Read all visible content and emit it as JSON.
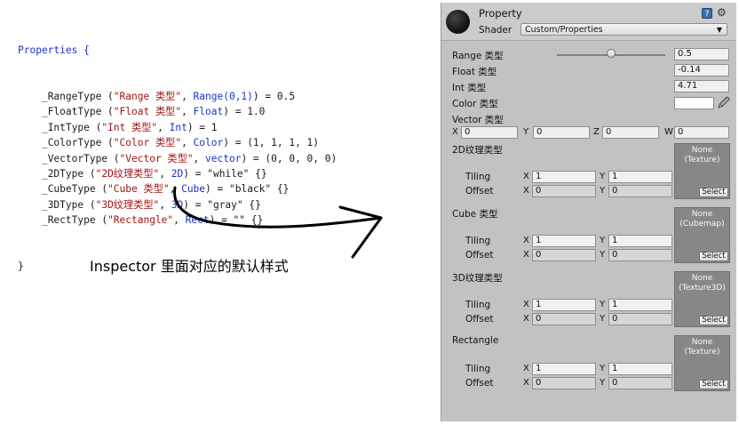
{
  "code": {
    "open": "Properties {",
    "close": "}",
    "lines": [
      {
        "name": "_RangeType",
        "label": "\"Range 类型\"",
        "type": "Range(0,1)",
        "value": "0.5"
      },
      {
        "name": "_FloatType",
        "label": "\"Float 类型\"",
        "type": "Float",
        "value": "1.0"
      },
      {
        "name": "_IntType",
        "label": "\"Int 类型\"",
        "type": "Int",
        "value": "1"
      },
      {
        "name": "_ColorType",
        "label": "\"Color 类型\"",
        "type": "Color",
        "value": "(1, 1, 1, 1)"
      },
      {
        "name": "_VectorType",
        "label": "\"Vector 类型\"",
        "type": "vector",
        "value": "(0, 0, 0, 0)"
      },
      {
        "name": "_2DType",
        "label": "\"2D纹理类型\"",
        "type": "2D",
        "value": "\"while\" {}"
      },
      {
        "name": "_CubeType",
        "label": "\"Cube 类型\"",
        "type": "Cube",
        "value": "\"black\" {}"
      },
      {
        "name": "_3DType",
        "label": "\"3D纹理类型\"",
        "type": "3D",
        "value": "\"gray\" {}"
      },
      {
        "name": "_RectType",
        "label": "\"Rectangle\"",
        "type": "Rect",
        "value": "\"\" {}"
      }
    ]
  },
  "caption": "Inspector 里面对应的默认样式",
  "inspector": {
    "title": "Property",
    "shader_label": "Shader",
    "shader_value": "Custom/Properties",
    "help_icon": "help-book-icon",
    "gear_icon": "gear-icon",
    "range": {
      "label": "Range 类型",
      "value": "0.5",
      "slider_fraction": 0.5
    },
    "float": {
      "label": "Float 类型",
      "value": "-0.14"
    },
    "int": {
      "label": "Int 类型",
      "value": "4.71"
    },
    "color": {
      "label": "Color 类型",
      "swatch": "#ffffff"
    },
    "vector": {
      "label": "Vector 类型",
      "x_label": "X",
      "y_label": "Y",
      "z_label": "Z",
      "w_label": "W",
      "x": "0",
      "y": "0",
      "z": "0",
      "w": "0"
    },
    "textures": [
      {
        "label": "2D纹理类型",
        "tiling_label": "Tiling",
        "offset_label": "Offset",
        "tiling_x": "1",
        "tiling_y": "1",
        "offset_x": "0",
        "offset_y": "0",
        "slot_line1": "None",
        "slot_line2": "(Texture)",
        "select": "Select"
      },
      {
        "label": "Cube 类型",
        "tiling_label": "Tiling",
        "offset_label": "Offset",
        "tiling_x": "1",
        "tiling_y": "1",
        "offset_x": "0",
        "offset_y": "0",
        "slot_line1": "None",
        "slot_line2": "(Cubemap)",
        "select": "Select"
      },
      {
        "label": "3D纹理类型",
        "tiling_label": "Tiling",
        "offset_label": "Offset",
        "tiling_x": "1",
        "tiling_y": "1",
        "offset_x": "0",
        "offset_y": "0",
        "slot_line1": "None",
        "slot_line2": "(Texture3D)",
        "select": "Select"
      },
      {
        "label": "Rectangle",
        "tiling_label": "Tiling",
        "offset_label": "Offset",
        "tiling_x": "1",
        "tiling_y": "1",
        "offset_x": "0",
        "offset_y": "0",
        "slot_line1": "None",
        "slot_line2": "(Texture)",
        "select": "Select"
      }
    ],
    "xy_labels": {
      "x": "X",
      "y": "Y"
    }
  }
}
